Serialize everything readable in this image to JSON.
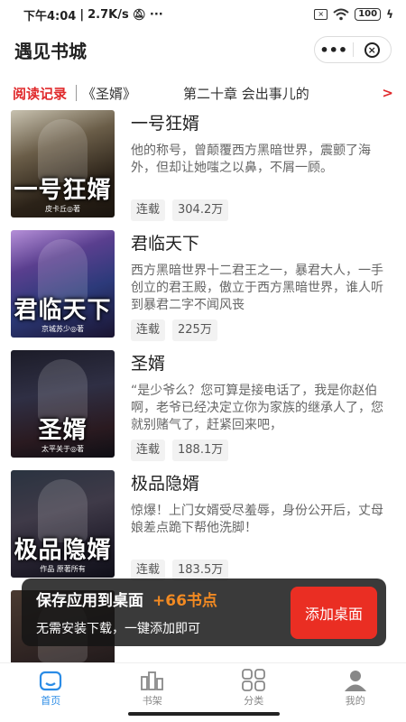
{
  "status_bar": {
    "time": "下午4:04",
    "speed": "2.7K/s",
    "battery": "100"
  },
  "header": {
    "title": "遇见书城",
    "more_label": "•••",
    "close_label": "×"
  },
  "record": {
    "label": "阅读记录",
    "book": "《圣婿》",
    "chapter": "第二十章 会出事儿的",
    "arrow": ">"
  },
  "books": [
    {
      "title": "一号狂婿",
      "cover_text": "一号狂婿",
      "cover_author": "皮卡丘◎著",
      "desc": "他的称号，曾颠覆西方黑暗世界，震颤了海外，但却让她嗤之以鼻，不屑一顾。",
      "status": "连载",
      "count": "304.2万"
    },
    {
      "title": "君临天下",
      "cover_text": "君临天下",
      "cover_author": "京城苏少◎著",
      "desc": "西方黑暗世界十二君王之一，暴君大人，一手创立的君王殿，傲立于西方黑暗世界，谁人听到暴君二字不闻风丧",
      "status": "连载",
      "count": "225万"
    },
    {
      "title": "圣婿",
      "cover_text": "圣婿",
      "cover_author": "太平关于◎著",
      "desc": "“是少爷么？您可算是接电话了，我是你赵伯啊，老爷已经决定立你为家族的继承人了，您就别赌气了，赶紧回来吧，",
      "status": "连载",
      "count": "188.1万"
    },
    {
      "title": "极品隐婿",
      "cover_text": "极品隐婿",
      "cover_author": "作品 原著所有",
      "desc": "惊爆！上门女婿受尽羞辱，身份公开后，丈母娘差点跪下帮他洗脚！",
      "status": "连载",
      "count": "183.5万"
    },
    {
      "title": "",
      "cover_text": "",
      "cover_author": "",
      "desc": "",
      "status": "",
      "count": ""
    }
  ],
  "toast": {
    "title": "保存应用到桌面",
    "points": "+66书点",
    "subtitle": "无需安装下载，一键添加即可",
    "button": "添加桌面"
  },
  "tabs": [
    {
      "label": "首页",
      "icon": "home-icon",
      "active": true
    },
    {
      "label": "书架",
      "icon": "bookshelf-icon",
      "active": false
    },
    {
      "label": "分类",
      "icon": "category-grid-icon",
      "active": false
    },
    {
      "label": "我的",
      "icon": "profile-icon",
      "active": false
    }
  ],
  "colors": {
    "accent_red": "#e0292b",
    "button_red": "#ea2e23",
    "points_orange": "#f28a22",
    "tab_active_blue": "#2b8ce6"
  }
}
